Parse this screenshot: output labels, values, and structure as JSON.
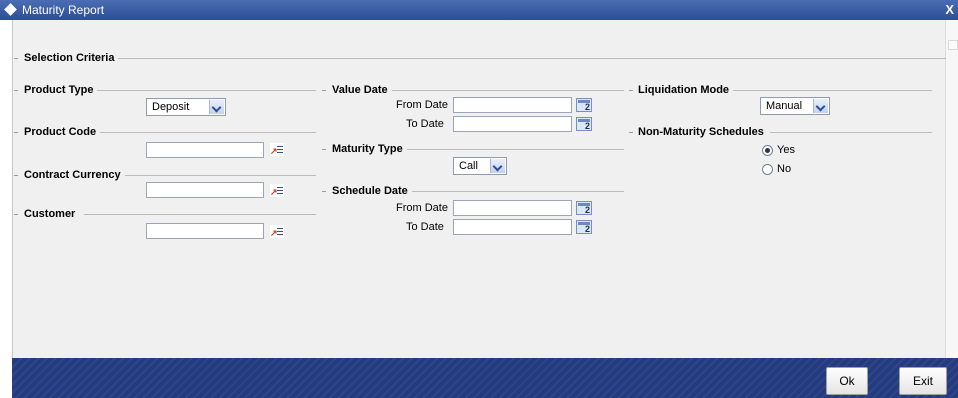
{
  "window": {
    "title": "Maturity Report",
    "close_label": "X"
  },
  "selection_criteria": {
    "label": "Selection Criteria"
  },
  "product_type": {
    "label": "Product Type",
    "selected": "Deposit"
  },
  "product_code": {
    "label": "Product Code",
    "value": ""
  },
  "contract_currency": {
    "label": "Contract Currency",
    "value": ""
  },
  "customer": {
    "label": "Customer",
    "value": ""
  },
  "value_date": {
    "label": "Value Date",
    "from_label": "From Date",
    "to_label": "To Date",
    "from_value": "",
    "to_value": ""
  },
  "maturity_type": {
    "label": "Maturity Type",
    "selected": "Call"
  },
  "schedule_date": {
    "label": "Schedule Date",
    "from_label": "From Date",
    "to_label": "To Date",
    "from_value": "",
    "to_value": ""
  },
  "liquidation_mode": {
    "label": "Liquidation Mode",
    "selected": "Manual"
  },
  "non_maturity_schedules": {
    "label": "Non-Maturity Schedules",
    "options": [
      "Yes",
      "No"
    ],
    "selected": "Yes"
  },
  "footer": {
    "ok_label": "Ok",
    "exit_label": "Exit"
  },
  "colors": {
    "titlebar": "#2c4e97",
    "footer": "#243c7f",
    "panel": "#f0f0f0"
  },
  "icons": {
    "lov": "lov-icon",
    "calendar": "calendar-icon"
  }
}
